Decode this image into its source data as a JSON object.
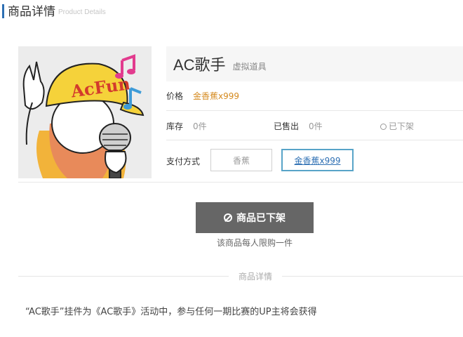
{
  "header": {
    "title": "商品详情",
    "subtitle": "Product Details"
  },
  "product": {
    "name": "AC歌手",
    "tag": "虚拟道具",
    "image_logo_text": "AcFun",
    "price_label": "价格",
    "price_value": "金香蕉x999",
    "stock_label": "库存",
    "stock_value": "0件",
    "sold_label": "已售出",
    "sold_value": "0件",
    "status_text": "已下架",
    "payment_label": "支付方式",
    "payment_options": [
      {
        "label": "香蕉",
        "selected": false
      },
      {
        "label": "金香蕉x999",
        "selected": true
      }
    ]
  },
  "action": {
    "button_label": "商品已下架",
    "limit_note": "该商品每人限购一件"
  },
  "details": {
    "section_label": "商品详情",
    "description": "“AC歌手”挂件为《AC歌手》活动中，参与任何一期比赛的UP主将会获得"
  },
  "colors": {
    "accent_blue": "#2d6fb3",
    "price_orange": "#d58a1f",
    "button_gray": "#666666",
    "selected_border": "#58a4c8"
  }
}
